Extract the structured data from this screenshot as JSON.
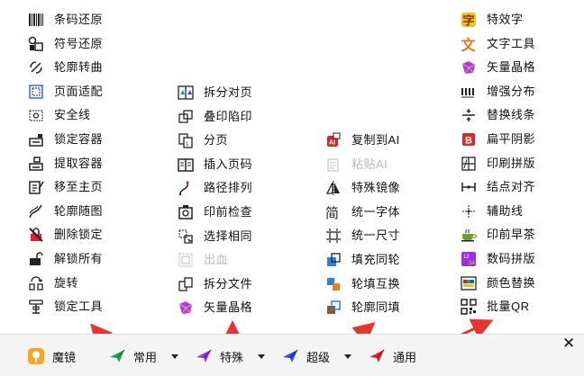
{
  "columns": {
    "col1": [
      {
        "label": "条码还原",
        "icon": "barcode-icon"
      },
      {
        "label": "符号还原",
        "icon": "symbol-icon"
      },
      {
        "label": "轮廓转曲",
        "icon": "outline-curve-icon"
      },
      {
        "label": "页面适配",
        "icon": "page-fit-icon"
      },
      {
        "label": "安全线",
        "icon": "safety-line-icon"
      },
      {
        "label": "锁定容器",
        "icon": "lock-container-icon"
      },
      {
        "label": "提取容器",
        "icon": "extract-container-icon"
      },
      {
        "label": "移至主页",
        "icon": "move-to-master-icon"
      },
      {
        "label": "轮廓随图",
        "icon": "outline-follow-icon"
      },
      {
        "label": "删除锁定",
        "icon": "delete-lock-icon"
      },
      {
        "label": "解锁所有",
        "icon": "unlock-all-icon"
      },
      {
        "label": "旋转",
        "icon": "rotate-icon"
      },
      {
        "label": "锁定工具",
        "icon": "lock-tool-icon"
      }
    ],
    "col2": [
      {
        "label": "拆分对页",
        "icon": "split-spread-icon"
      },
      {
        "label": "叠印陷印",
        "icon": "overprint-trap-icon"
      },
      {
        "label": "分页",
        "icon": "paginate-icon"
      },
      {
        "label": "插入页码",
        "icon": "insert-page-number-icon"
      },
      {
        "label": "路径排列",
        "icon": "path-arrange-icon"
      },
      {
        "label": "印前检查",
        "icon": "preflight-icon"
      },
      {
        "label": "选择相同",
        "icon": "select-same-icon"
      },
      {
        "label": "出血",
        "icon": "bleed-icon",
        "disabled": true
      },
      {
        "label": "拆分文件",
        "icon": "split-file-icon"
      },
      {
        "label": "矢量晶格",
        "icon": "vector-crystal-icon"
      }
    ],
    "col3": [
      {
        "label": "复制到AI",
        "icon": "copy-to-ai-icon"
      },
      {
        "label": "粘贴AI",
        "icon": "paste-ai-icon",
        "disabled": true
      },
      {
        "label": "特殊镜像",
        "icon": "special-mirror-icon"
      },
      {
        "label": "统一字体",
        "icon": "unify-font-icon"
      },
      {
        "label": "统一尺寸",
        "icon": "unify-size-icon"
      },
      {
        "label": "填充同轮",
        "icon": "fill-same-outline-icon"
      },
      {
        "label": "轮填互换",
        "icon": "swap-fill-outline-icon"
      },
      {
        "label": "轮廓同填",
        "icon": "outline-same-fill-icon"
      }
    ],
    "col4": [
      {
        "label": "特效字",
        "icon": "effect-text-icon"
      },
      {
        "label": "文字工具",
        "icon": "text-tool-icon"
      },
      {
        "label": "矢量晶格",
        "icon": "vector-crystal-icon"
      },
      {
        "label": "增强分布",
        "icon": "enhanced-distribute-icon"
      },
      {
        "label": "替换线条",
        "icon": "replace-lines-icon"
      },
      {
        "label": "扁平阴影",
        "icon": "flat-shadow-icon"
      },
      {
        "label": "印刷拼版",
        "icon": "imposition-icon"
      },
      {
        "label": "结点对齐",
        "icon": "node-align-icon"
      },
      {
        "label": "辅助线",
        "icon": "guideline-icon"
      },
      {
        "label": "印前早茶",
        "icon": "prepress-tea-icon"
      },
      {
        "label": "数码拼版",
        "icon": "digital-imposition-icon"
      },
      {
        "label": "颜色替换",
        "icon": "color-replace-icon"
      },
      {
        "label": "批量QR",
        "icon": "batch-qr-icon"
      }
    ]
  },
  "toolbar": {
    "app_label": "魔镜",
    "common_label": "常用",
    "special_label": "特殊",
    "super_label": "超级",
    "general_label": "通用",
    "close_glyph": "✕"
  },
  "colors": {
    "accent_green": "#1aa64a",
    "accent_purple": "#9b30e0",
    "accent_blue": "#2050e0",
    "accent_red": "#e0202a",
    "arrow_red": "#e8342c",
    "app_orange": "#f5a623"
  }
}
